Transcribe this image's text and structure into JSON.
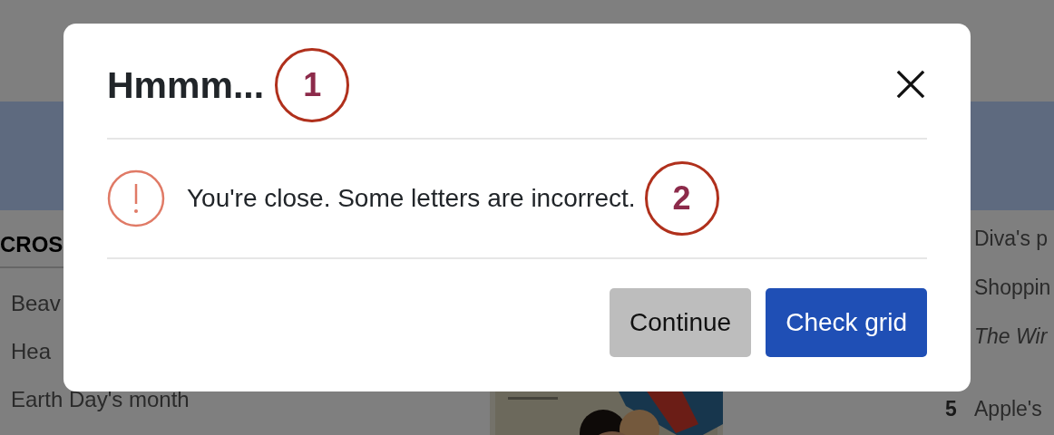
{
  "background": {
    "clues_left": {
      "heading": "CROS",
      "items": [
        {
          "text": "Beav"
        },
        {
          "text": "Hea"
        },
        {
          "text": "Earth Day's month"
        }
      ]
    },
    "clues_right": {
      "items": [
        {
          "text": "Diva's p",
          "italic": false
        },
        {
          "text": "Shoppin",
          "italic": false
        },
        {
          "text": "The Wir",
          "italic": true
        },
        {
          "number": "5",
          "text": "Apple's",
          "italic": false
        }
      ]
    }
  },
  "dialog": {
    "title": "Hmmm...",
    "title_annotation": "1",
    "message": "You're close. Some letters are incorrect.",
    "message_annotation": "2",
    "buttons": [
      {
        "label": "Continue",
        "kind": "secondary"
      },
      {
        "label": "Check grid",
        "kind": "primary"
      }
    ]
  }
}
